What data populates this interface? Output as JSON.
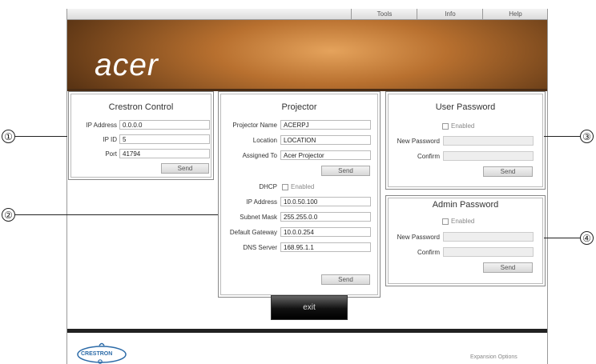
{
  "nav": {
    "tabs": [
      "Tools",
      "Info",
      "Help"
    ]
  },
  "brand": {
    "logo": "acer",
    "footer_logo": "CRESTRON"
  },
  "crestron": {
    "title": "Crestron Control",
    "ip_label": "IP Address",
    "ip_value": "0.0.0.0",
    "ipid_label": "IP ID",
    "ipid_value": "5",
    "port_label": "Port",
    "port_value": "41794",
    "send": "Send"
  },
  "projector": {
    "title": "Projector",
    "name_label": "Projector Name",
    "name_value": "ACERPJ",
    "location_label": "Location",
    "location_value": "LOCATION",
    "assigned_label": "Assigned To",
    "assigned_value": "Acer Projector",
    "send1": "Send",
    "dhcp_label": "DHCP",
    "dhcp_enabled": "Enabled",
    "ip_label": "IP Address",
    "ip_value": "10.0.50.100",
    "subnet_label": "Subnet Mask",
    "subnet_value": "255.255.0.0",
    "gateway_label": "Default Gateway",
    "gateway_value": "10.0.0.254",
    "dns_label": "DNS Server",
    "dns_value": "168.95.1.1",
    "send2": "Send"
  },
  "user_password": {
    "title": "User Password",
    "enabled": "Enabled",
    "new_label": "New Password",
    "new_value": "",
    "confirm_label": "Confirm",
    "confirm_value": "",
    "send": "Send"
  },
  "admin_password": {
    "title": "Admin Password",
    "enabled": "Enabled",
    "new_label": "New Password",
    "new_value": "",
    "confirm_label": "Confirm",
    "confirm_value": "",
    "send": "Send"
  },
  "exit_label": "exit",
  "footer": {
    "expansion": "Expansion Options"
  },
  "callouts": [
    "①",
    "②",
    "③",
    "④"
  ]
}
